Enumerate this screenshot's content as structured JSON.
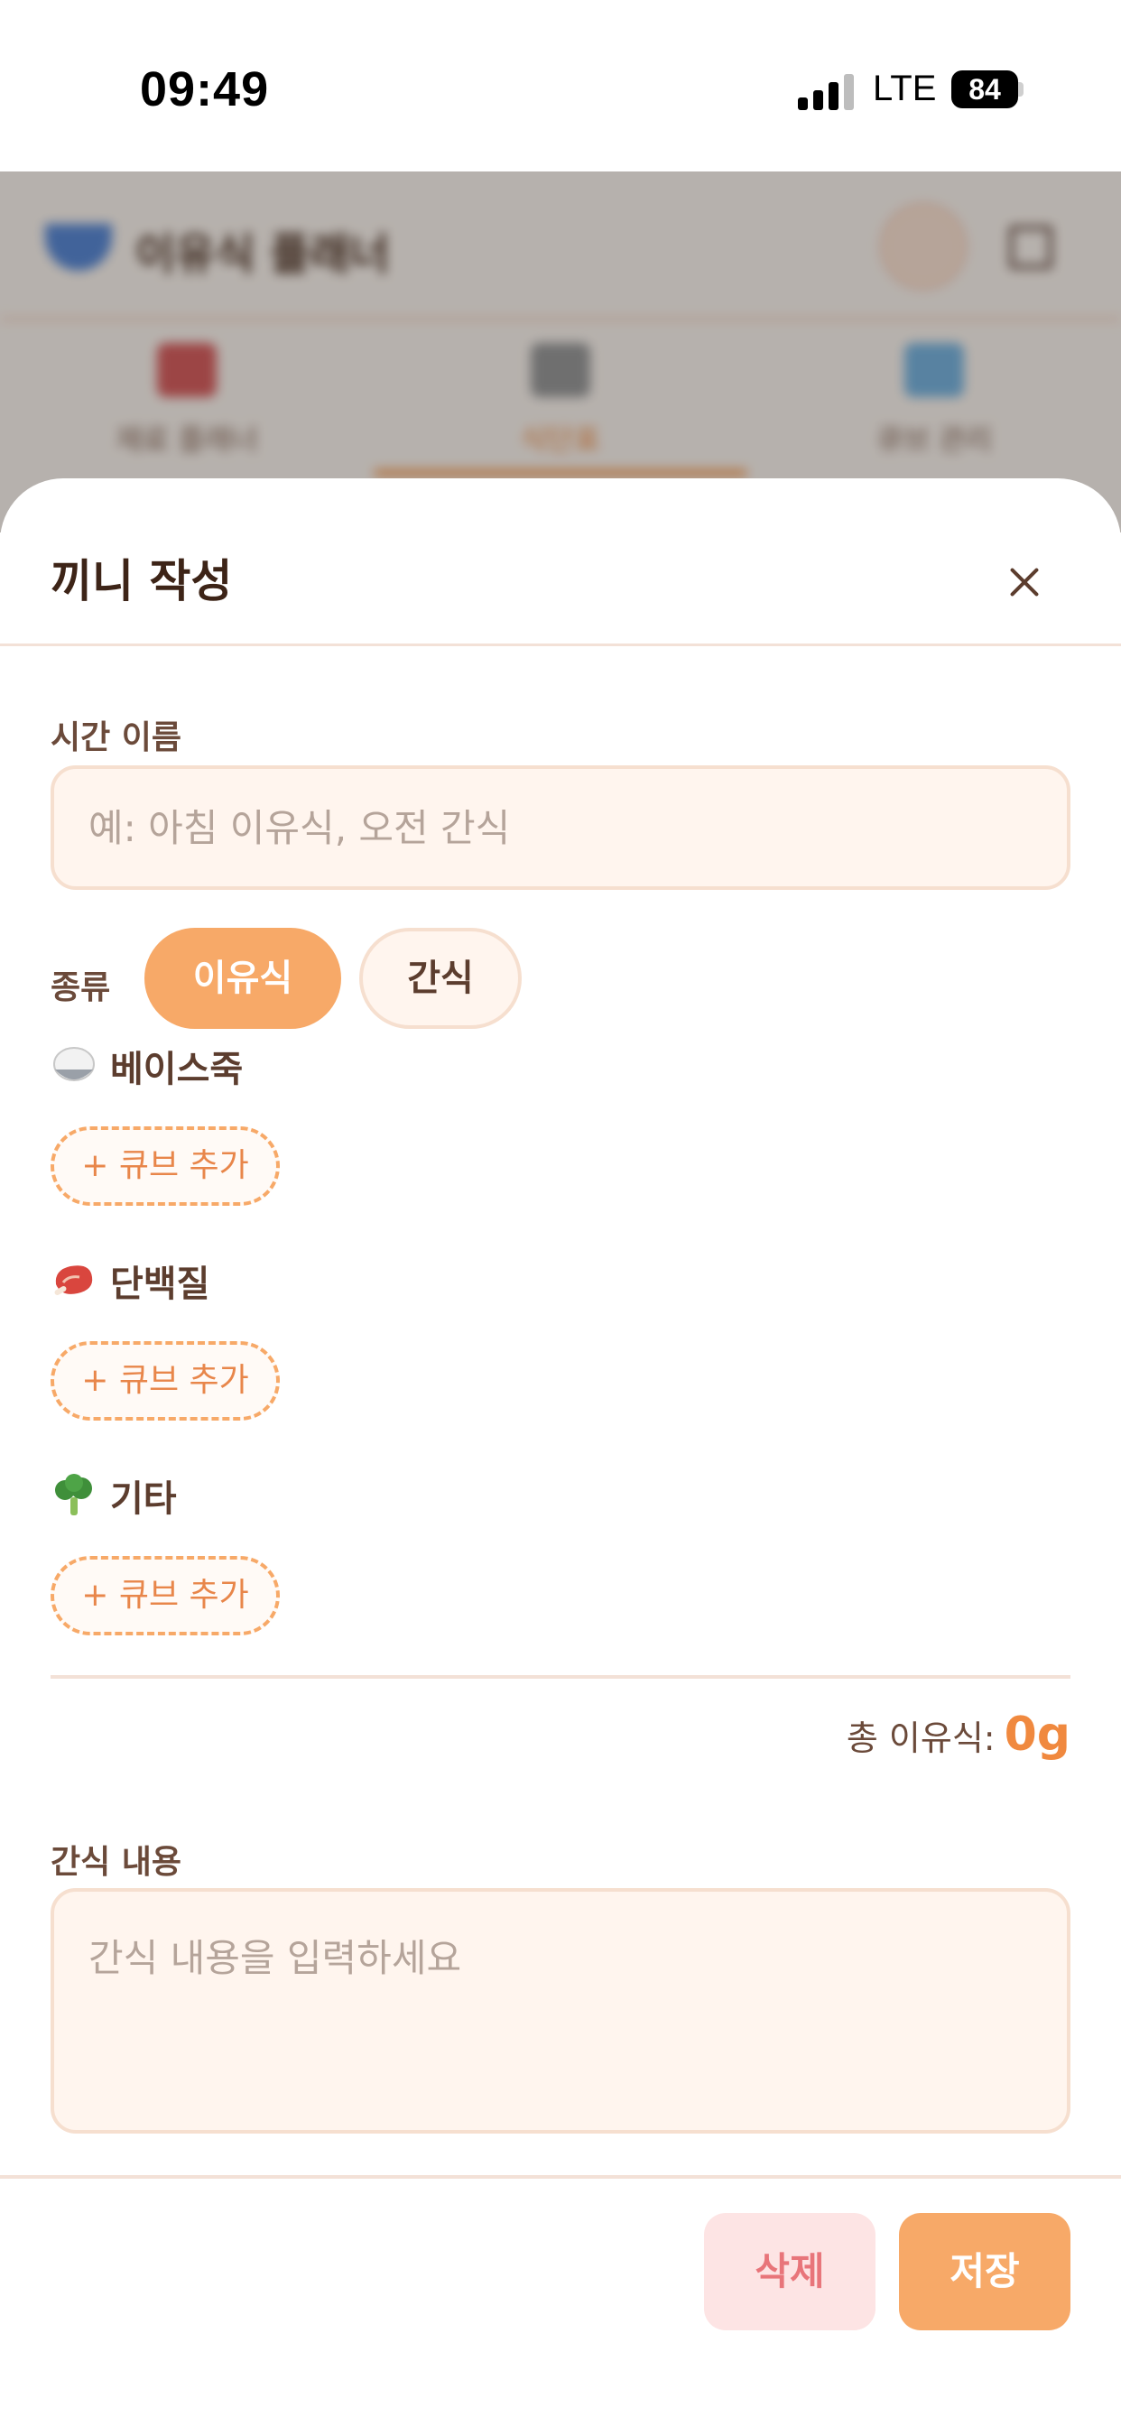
{
  "status_bar": {
    "time": "09:49",
    "network": "LTE",
    "battery": "84"
  },
  "background_app": {
    "title": "이유식 플래너",
    "tabs": [
      {
        "label": "재료 플래너"
      },
      {
        "label": "식단표"
      },
      {
        "label": "큐브 관리"
      }
    ]
  },
  "sheet": {
    "title": "끼니 작성",
    "time_name": {
      "label": "시간 이름",
      "placeholder": "예: 아침 이유식, 오전 간식",
      "value": ""
    },
    "type": {
      "label": "종류",
      "options": [
        "이유식",
        "간식"
      ],
      "selected": "이유식"
    },
    "categories": [
      {
        "name": "베이스죽",
        "icon": "rice-bowl-icon",
        "add_label": "+ 큐브 추가"
      },
      {
        "name": "단백질",
        "icon": "meat-icon",
        "add_label": "+ 큐브 추가"
      },
      {
        "name": "기타",
        "icon": "broccoli-icon",
        "add_label": "+ 큐브 추가"
      }
    ],
    "total": {
      "label": "총 이유식:",
      "value": "0g"
    },
    "snack": {
      "label": "간식 내용",
      "placeholder": "간식 내용을 입력하세요",
      "value": ""
    },
    "buttons": {
      "delete": "삭제",
      "save": "저장"
    }
  },
  "colors": {
    "accent": "#f7a968",
    "accent_text": "#f0893f",
    "delete_bg": "#fde4e4",
    "delete_text": "#e8757a",
    "input_bg": "#fff5ee"
  }
}
